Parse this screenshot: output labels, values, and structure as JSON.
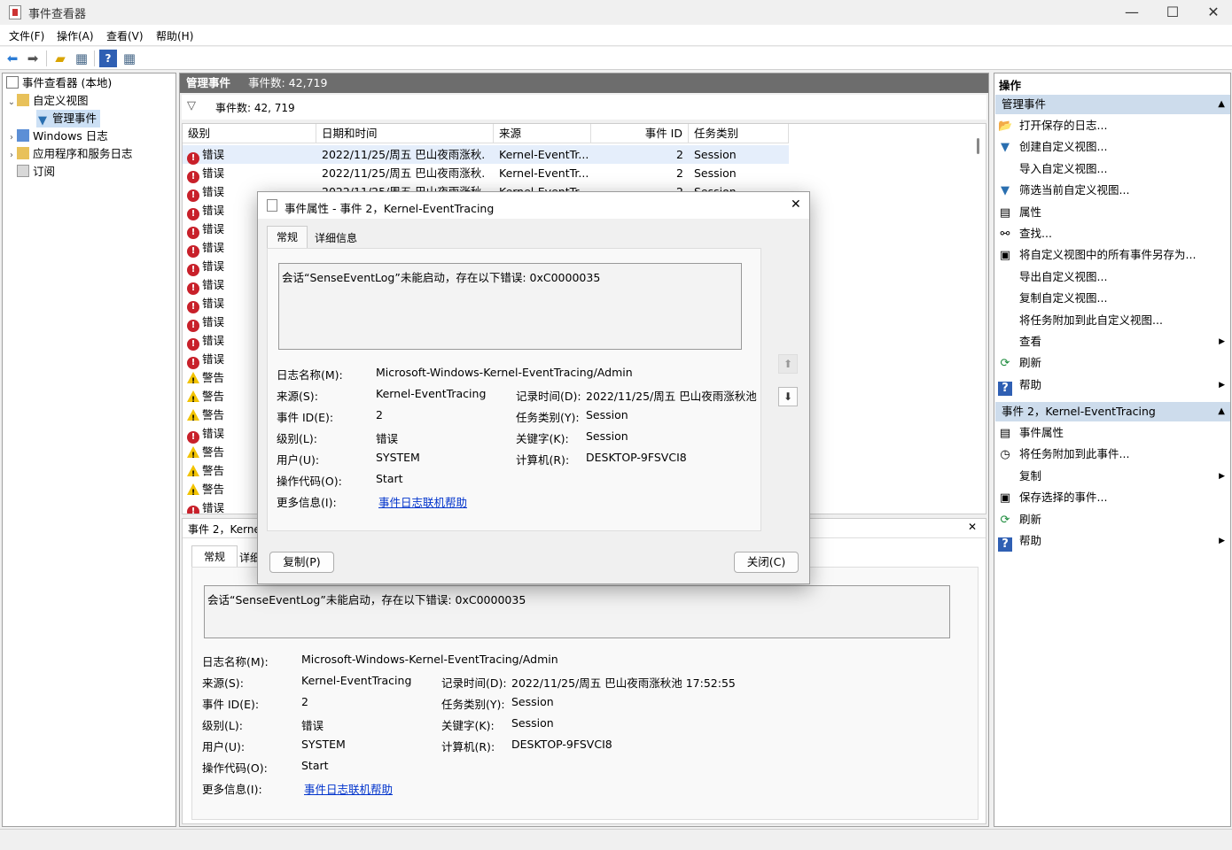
{
  "window": {
    "title": "事件查看器",
    "minimize": "—",
    "maximize": "☐",
    "close": "✕"
  },
  "menu": [
    "文件(F)",
    "操作(A)",
    "查看(V)",
    "帮助(H)"
  ],
  "tree": {
    "root": "事件查看器 (本地)",
    "custom_views": "自定义视图",
    "admin_events": "管理事件",
    "windows_logs": "Windows 日志",
    "app_service_logs": "应用程序和服务日志",
    "subscriptions": "订阅"
  },
  "center": {
    "header_title": "管理事件",
    "header_count": "事件数: 42,719",
    "filter_text": "事件数:  42, 719",
    "columns": {
      "level": "级别",
      "datetime": "日期和时间",
      "source": "来源",
      "event_id": "事件 ID",
      "task": "任务类别"
    },
    "rows": [
      {
        "level": "错误",
        "type": "error",
        "datetime": "2022/11/25/周五 巴山夜雨涨秋...",
        "source": "Kernel-EventTr...",
        "id": "2",
        "task": "Session"
      },
      {
        "level": "错误",
        "type": "error",
        "datetime": "2022/11/25/周五 巴山夜雨涨秋...",
        "source": "Kernel-EventTr...",
        "id": "2",
        "task": "Session"
      },
      {
        "level": "错误",
        "type": "error",
        "datetime": "2022/11/25/周五 巴山夜雨涨秋...",
        "source": "Kernel-EventTr...",
        "id": "2",
        "task": "Session"
      },
      {
        "level": "错误",
        "type": "error"
      },
      {
        "level": "错误",
        "type": "error"
      },
      {
        "level": "错误",
        "type": "error"
      },
      {
        "level": "错误",
        "type": "error"
      },
      {
        "level": "错误",
        "type": "error"
      },
      {
        "level": "错误",
        "type": "error"
      },
      {
        "level": "错误",
        "type": "error"
      },
      {
        "level": "错误",
        "type": "error"
      },
      {
        "level": "错误",
        "type": "error"
      },
      {
        "level": "警告",
        "type": "warning"
      },
      {
        "level": "警告",
        "type": "warning"
      },
      {
        "level": "警告",
        "type": "warning"
      },
      {
        "level": "错误",
        "type": "error"
      },
      {
        "level": "警告",
        "type": "warning"
      },
      {
        "level": "警告",
        "type": "warning"
      },
      {
        "level": "警告",
        "type": "warning"
      },
      {
        "level": "错误",
        "type": "error"
      }
    ]
  },
  "detail": {
    "title": "事件 2，Kernel",
    "tab_general": "常规",
    "tab_details": "详细",
    "message": "会话“SenseEventLog”未能启动，存在以下错误: 0xC0000035",
    "labels": {
      "log_name": "日志名称(M):",
      "source": "来源(S):",
      "logged": "记录时间(D):",
      "event_id": "事件 ID(E):",
      "task": "任务类别(Y):",
      "level": "级别(L):",
      "keywords": "关键字(K):",
      "user": "用户(U):",
      "computer": "计算机(R):",
      "opcode": "操作代码(O):",
      "more_info": "更多信息(I):"
    },
    "values": {
      "log_name": "Microsoft-Windows-Kernel-EventTracing/Admin",
      "source": "Kernel-EventTracing",
      "logged": "2022/11/25/周五 巴山夜雨涨秋池 17:52:55",
      "event_id": "2",
      "task": "Session",
      "level": "错误",
      "keywords": "Session",
      "user": "SYSTEM",
      "computer": "DESKTOP-9FSVCI8",
      "opcode": "Start",
      "more_info_link": "事件日志联机帮助"
    },
    "close": "✕"
  },
  "dialog": {
    "title": "事件属性 - 事件 2，Kernel-EventTracing",
    "tab_general": "常规",
    "tab_details": "详细信息",
    "message": "会话“SenseEventLog”未能启动，存在以下错误: 0xC0000035",
    "logged": "2022/11/25/周五 巴山夜雨涨秋池",
    "copy_button": "复制(P)",
    "close_button": "关闭(C)",
    "close_x": "✕"
  },
  "actions": {
    "header": "操作",
    "section1": "管理事件",
    "items1": [
      {
        "label": "打开保存的日志...",
        "icon": "folder-open-icon",
        "glyph": "📂"
      },
      {
        "label": "创建自定义视图...",
        "icon": "filter-create-icon",
        "glyph": "▼"
      },
      {
        "label": "导入自定义视图...",
        "icon": "",
        "glyph": ""
      },
      {
        "label": "筛选当前自定义视图...",
        "icon": "filter-icon",
        "glyph": "▼"
      },
      {
        "label": "属性",
        "icon": "properties-icon",
        "glyph": "▤"
      },
      {
        "label": "查找...",
        "icon": "binoculars-icon",
        "glyph": "⚯"
      },
      {
        "label": "将自定义视图中的所有事件另存为...",
        "icon": "save-icon",
        "glyph": "▣"
      },
      {
        "label": "导出自定义视图...",
        "icon": "",
        "glyph": ""
      },
      {
        "label": "复制自定义视图...",
        "icon": "",
        "glyph": ""
      },
      {
        "label": "将任务附加到此自定义视图...",
        "icon": "",
        "glyph": ""
      },
      {
        "label": "查看",
        "icon": "",
        "glyph": "",
        "submenu": true
      },
      {
        "label": "刷新",
        "icon": "refresh-icon",
        "glyph": "⟳"
      },
      {
        "label": "帮助",
        "icon": "help-icon",
        "glyph": "?",
        "submenu": true
      }
    ],
    "section2": "事件 2，Kernel-EventTracing",
    "items2": [
      {
        "label": "事件属性",
        "icon": "event-properties-icon",
        "glyph": "▤"
      },
      {
        "label": "将任务附加到此事件...",
        "icon": "task-icon",
        "glyph": "◷"
      },
      {
        "label": "复制",
        "icon": "",
        "glyph": "",
        "submenu": true
      },
      {
        "label": "保存选择的事件...",
        "icon": "save-icon",
        "glyph": "▣"
      },
      {
        "label": "刷新",
        "icon": "refresh-icon",
        "glyph": "⟳"
      },
      {
        "label": "帮助",
        "icon": "help-icon",
        "glyph": "?",
        "submenu": true
      }
    ]
  }
}
